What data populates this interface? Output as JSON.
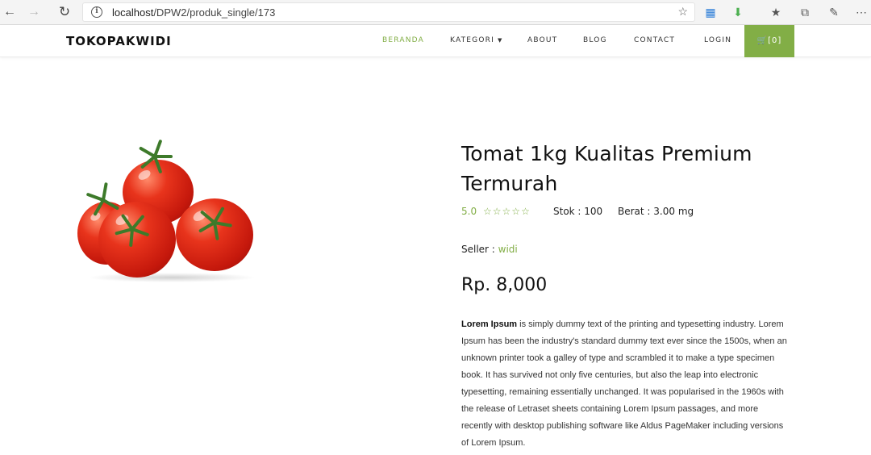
{
  "browser": {
    "url_host": "localhost",
    "url_path": "/DPW2/produk_single/173"
  },
  "header": {
    "brand": "TOKOPAKWIDI",
    "menu": [
      {
        "label": "BERANDA",
        "active": true
      },
      {
        "label": "KATEGORI",
        "active": false
      },
      {
        "label": "ABOUT",
        "active": false
      },
      {
        "label": "BLOG",
        "active": false
      },
      {
        "label": "CONTACT",
        "active": false
      },
      {
        "label": "LOGIN",
        "active": false
      }
    ],
    "cart_label": "[0]",
    "accent_color": "#82ae46"
  },
  "product": {
    "title": "Tomat 1kg Kualitas Premium Termurah",
    "rating": "5.0",
    "stars": 0,
    "stars_max": 5,
    "stok": "Stok : 100",
    "berat": "Berat : 3.00 mg",
    "seller_label": "Seller : ",
    "seller_name": "widi",
    "price": "Rp. 8,000",
    "description_lead": "Lorem Ipsum",
    "description_rest": " is simply dummy text of the printing and typesetting industry. Lorem Ipsum has been the industry's standard dummy text ever since the 1500s, when an unknown printer took a galley of type and scrambled it to make a type specimen book. It has survived not only five centuries, but also the leap into electronic typesetting, remaining essentially unchanged. It was popularised in the 1960s with the release of Letraset sheets containing Lorem Ipsum passages, and more recently with desktop publishing software like Aldus PageMaker including versions of Lorem Ipsum."
  },
  "icons": {
    "back": "back-arrow-icon",
    "forward": "forward-arrow-icon",
    "reload": "reload-icon",
    "info": "info-icon",
    "favorite": "star-icon",
    "cart": "cart-icon",
    "product_image": "tomato-image"
  }
}
